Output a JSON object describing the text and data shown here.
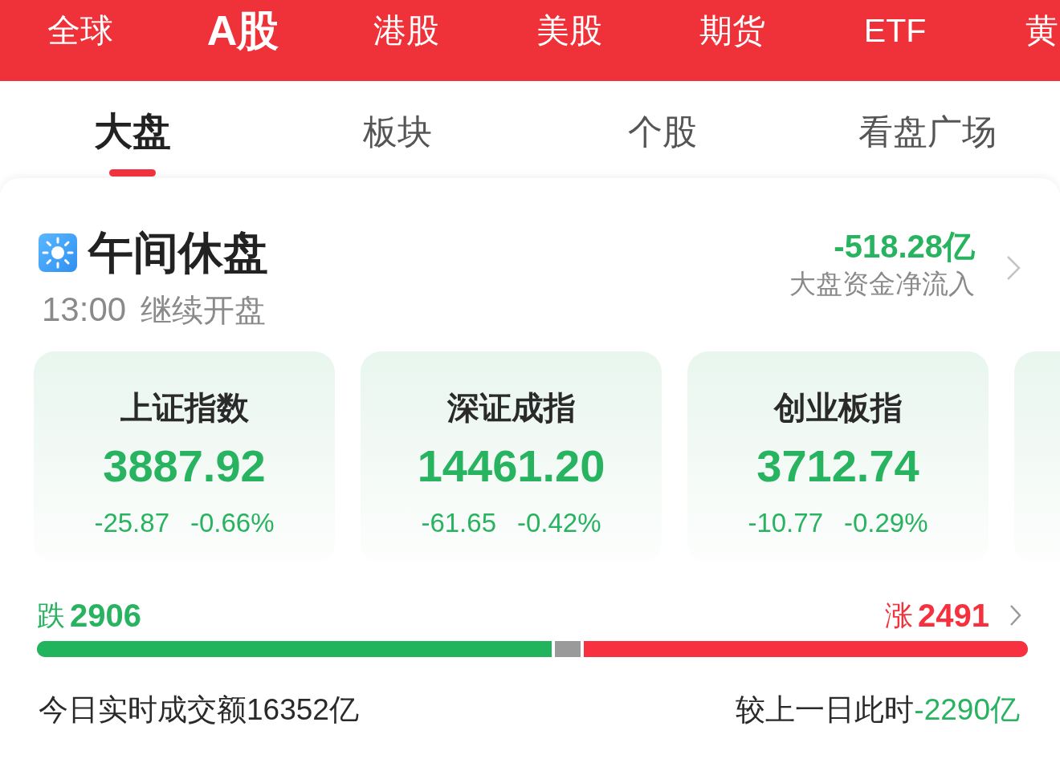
{
  "market_tabs": [
    {
      "label": "全球",
      "selected": false
    },
    {
      "label": "A股",
      "selected": true
    },
    {
      "label": "港股",
      "selected": false
    },
    {
      "label": "美股",
      "selected": false
    },
    {
      "label": "期货",
      "selected": false
    },
    {
      "label": "ETF",
      "selected": false
    },
    {
      "label": "黄",
      "selected": false
    }
  ],
  "view_tabs": [
    {
      "label": "大盘",
      "selected": true
    },
    {
      "label": "板块",
      "selected": false
    },
    {
      "label": "个股",
      "selected": false
    },
    {
      "label": "看盘广场",
      "selected": false
    }
  ],
  "session": {
    "title": "午间休盘",
    "resume_time": "13:00",
    "resume_label": "继续开盘"
  },
  "net_inflow": {
    "value": "-518.28亿",
    "label": "大盘资金净流入"
  },
  "indices": [
    {
      "name": "上证指数",
      "value": "3887.92",
      "change": "-25.87",
      "change_pct": "-0.66%"
    },
    {
      "name": "深证成指",
      "value": "14461.20",
      "change": "-61.65",
      "change_pct": "-0.42%"
    },
    {
      "name": "创业板指",
      "value": "3712.74",
      "change": "-10.77",
      "change_pct": "-0.29%"
    }
  ],
  "breadth": {
    "decline": {
      "label": "跌",
      "count": "2906",
      "level": 0.523
    },
    "advance": {
      "label": "涨",
      "count": "2491",
      "level": 0.451
    }
  },
  "turnover": {
    "text": "今日实时成交额16352亿",
    "compare_label": "较上一日此时",
    "compare_value": "-2290亿"
  }
}
